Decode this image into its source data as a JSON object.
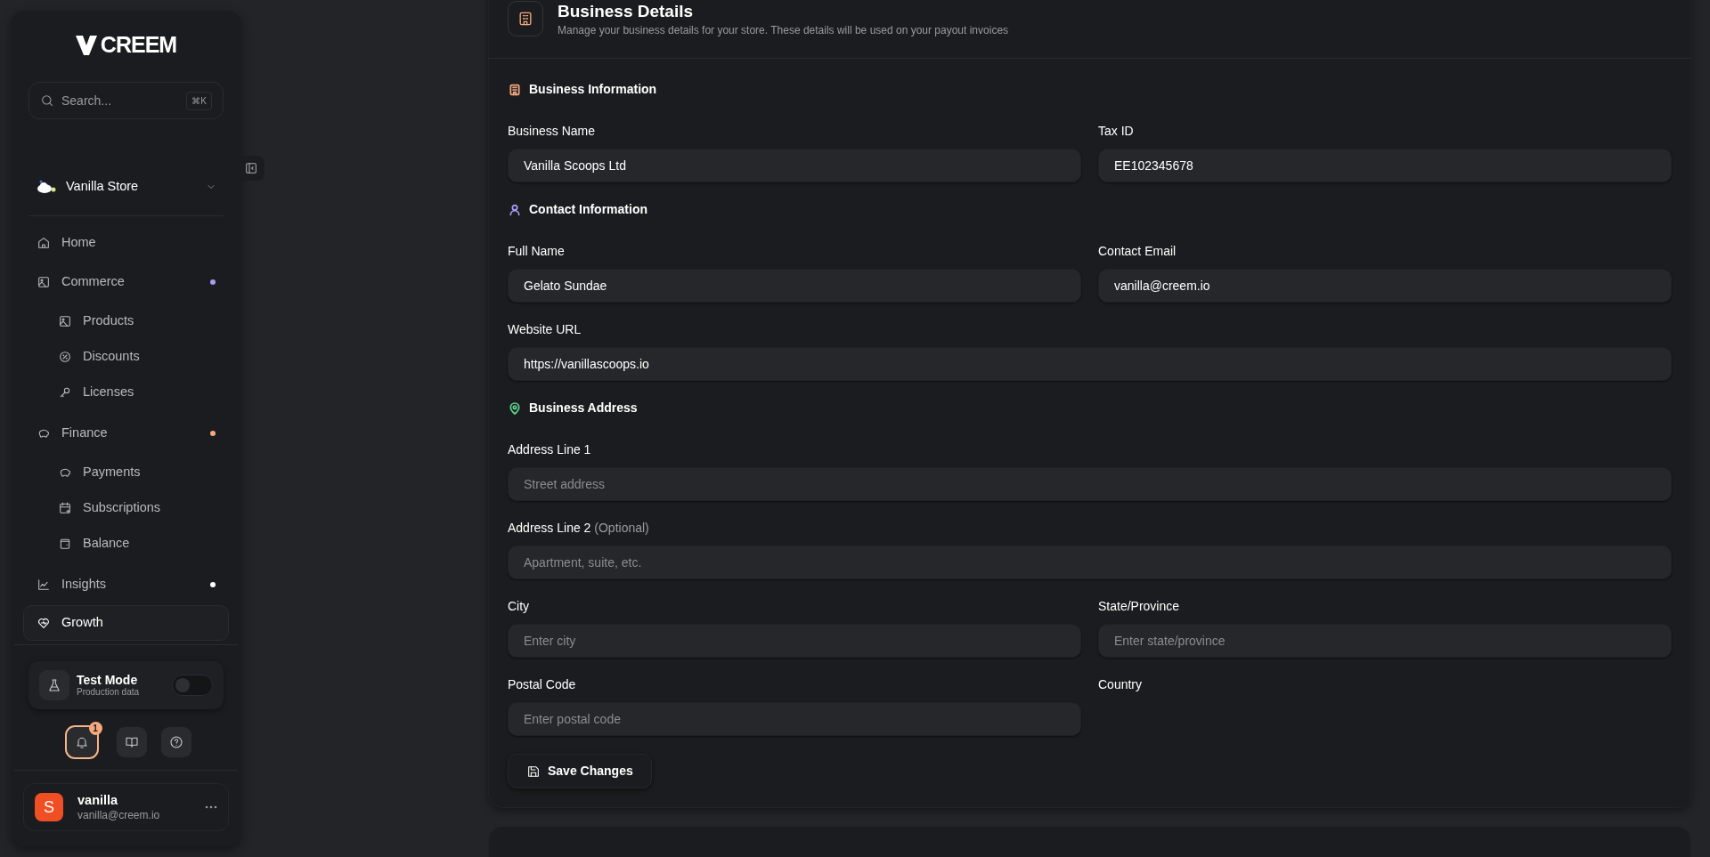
{
  "sidebar": {
    "logo": "CREEM",
    "search": {
      "placeholder": "Search...",
      "shortcut": "⌘K"
    },
    "store": {
      "name": "Vanilla Store"
    },
    "nav": [
      {
        "label": "Home",
        "selected": false
      },
      {
        "label": "Commerce",
        "selected": false,
        "color": "#a89cf7",
        "children": [
          {
            "label": "Products",
            "selected": false
          },
          {
            "label": "Discounts",
            "selected": false
          },
          {
            "label": "Licenses",
            "selected": false
          }
        ]
      },
      {
        "label": "Finance",
        "selected": false,
        "color": "#f5a97f",
        "children": [
          {
            "label": "Payments",
            "selected": false
          },
          {
            "label": "Subscriptions",
            "selected": false
          },
          {
            "label": "Balance",
            "selected": false
          }
        ]
      },
      {
        "label": "Insights",
        "selected": false,
        "color": "#ffffff"
      },
      {
        "label": "Growth",
        "selected": true
      }
    ],
    "test_mode": {
      "title": "Test Mode",
      "subtitle": "Production data",
      "on": false
    },
    "notifications": {
      "count": "1"
    },
    "user": {
      "initial": "S",
      "name": "vanilla",
      "email": "vanilla@creem.io"
    }
  },
  "page": {
    "title": "Business Details",
    "subtitle": "Manage your business details for your store. These details will be used on your payout invoices",
    "sections": [
      {
        "title": "Business Information",
        "color": "#f5a97f",
        "rows": [
          [
            {
              "label": "Business Name",
              "value": "Vanilla Scoops Ltd"
            },
            {
              "label": "Tax ID",
              "value": "EE102345678"
            }
          ]
        ]
      },
      {
        "title": "Contact Information",
        "color": "#a89cf7",
        "rows": [
          [
            {
              "label": "Full Name",
              "value": "Gelato Sundae"
            },
            {
              "label": "Contact Email",
              "value": "vanilla@creem.io"
            }
          ],
          [
            {
              "label": "Website URL",
              "value": "https://vanillascoops.io"
            }
          ]
        ]
      },
      {
        "title": "Business Address",
        "color": "#5fd38d",
        "rows": [
          [
            {
              "label": "Address Line 1",
              "placeholder": "Street address"
            }
          ],
          [
            {
              "label": "Address Line 2",
              "hint": "(Optional)",
              "placeholder": "Apartment, suite, etc."
            }
          ],
          [
            {
              "label": "City",
              "placeholder": "Enter city"
            },
            {
              "label": "State/Province",
              "placeholder": "Enter state/province"
            }
          ],
          [
            {
              "label": "Postal Code",
              "placeholder": "Enter postal code"
            },
            {
              "label": "Country"
            }
          ]
        ]
      }
    ],
    "save_button": "Save Changes"
  }
}
